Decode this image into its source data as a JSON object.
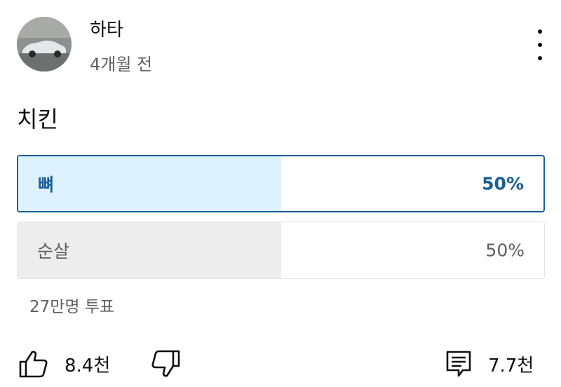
{
  "post": {
    "author": "하타",
    "time": "4개월 전",
    "question": "치킨"
  },
  "poll": {
    "options": [
      {
        "label": "뼈",
        "percent_text": "50%",
        "percent": 50,
        "selected": true
      },
      {
        "label": "순살",
        "percent_text": "50%",
        "percent": 50,
        "selected": false
      }
    ],
    "votes": "27만명 투표"
  },
  "actions": {
    "likes": "8.4천",
    "comments": "7.7천"
  },
  "colors": {
    "selected_border": "#1b5f95",
    "selected_fill": "#def1ff",
    "unselected_fill": "#ededed",
    "secondary_text": "#606060"
  },
  "icons": {
    "like": "thumb-up-icon",
    "dislike": "thumb-down-icon",
    "comments": "comment-icon",
    "menu": "more-vert-icon"
  }
}
